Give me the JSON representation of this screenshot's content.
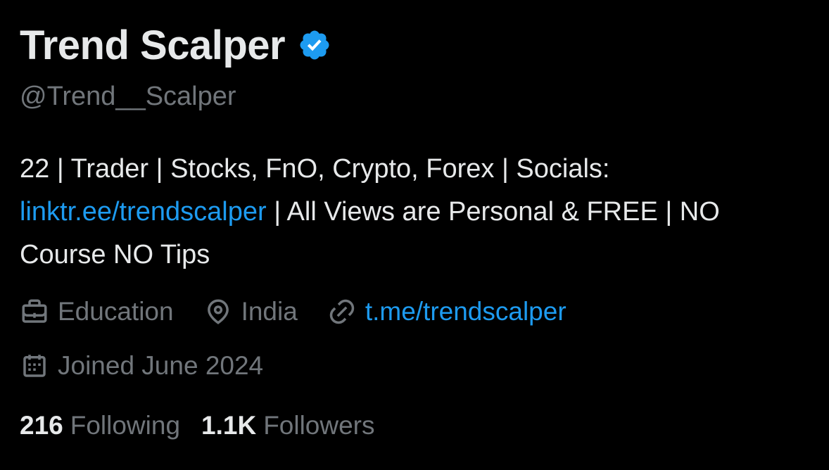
{
  "profile": {
    "display_name": "Trend Scalper",
    "verified_icon": "verified-badge-icon",
    "handle": "@Trend__Scalper",
    "bio": {
      "part1": "22 | Trader | Stocks, FnO, Crypto, Forex | Socials: ",
      "link": "linktr.ee/trendscalper",
      "part2": " | All Views are Personal & FREE | NO Course NO Tips"
    },
    "category": "Education",
    "location": "India",
    "website": "t.me/trendscalper",
    "joined": "Joined June 2024",
    "following_count": "216",
    "following_label": "Following",
    "followers_count": "1.1K",
    "followers_label": "Followers"
  },
  "colors": {
    "background": "#000000",
    "primary_text": "#e7e9ea",
    "secondary_text": "#71767b",
    "link": "#1d9bf0",
    "verified": "#1d9bf0"
  }
}
